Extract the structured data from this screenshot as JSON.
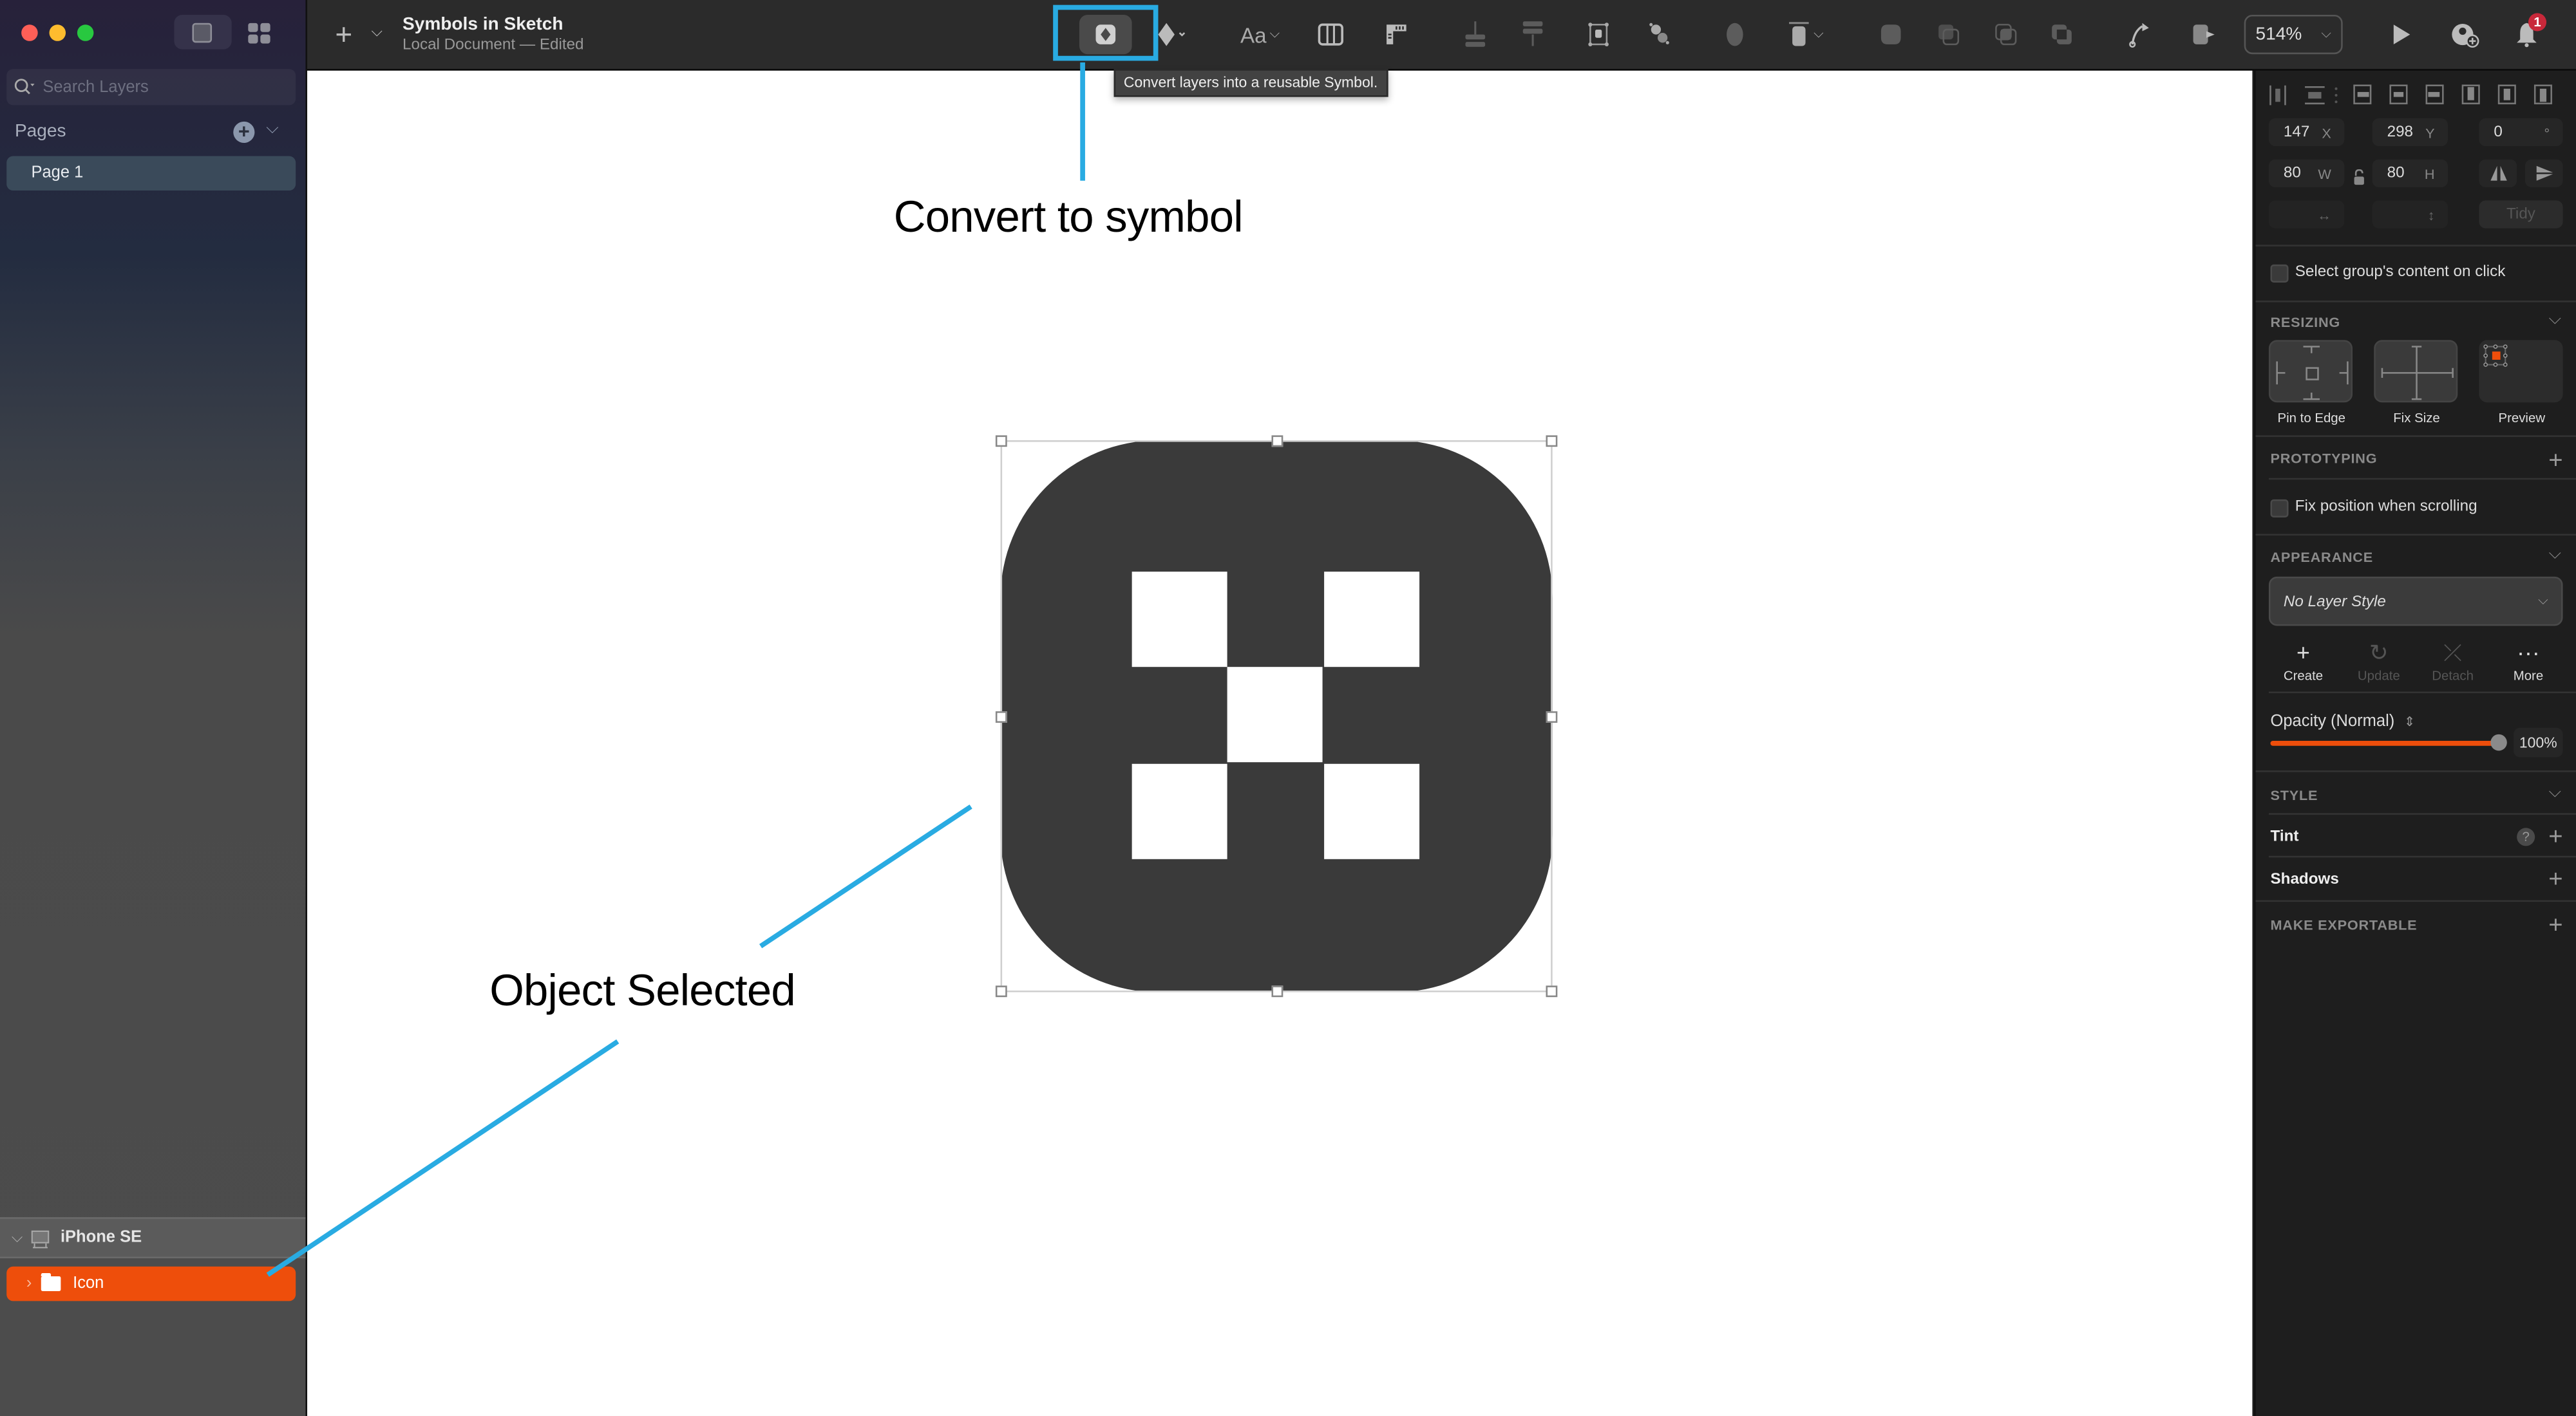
{
  "window": {
    "title": "Symbols in Sketch",
    "subtitle": "Local Document — Edited"
  },
  "sidebar": {
    "search_placeholder": "Search Layers",
    "pages_label": "Pages",
    "pages": [
      {
        "label": "Page 1",
        "selected": true
      }
    ],
    "layers": [
      {
        "label": "iPhone SE",
        "type": "artboard",
        "expanded": true
      },
      {
        "label": "Icon",
        "type": "group",
        "selected": true,
        "expanded": false
      }
    ]
  },
  "toolbar": {
    "insert_icon": "+",
    "zoom_level": "514%",
    "notification_count": "1",
    "text_tool_label": "Aa",
    "icons": [
      "plus-icon",
      "create-symbol-icon",
      "component-diamond-icon",
      "text-style-icon",
      "layout-grid-icon",
      "ruler-icon",
      "distribute-icon",
      "align-bottom-icon",
      "mask-icon",
      "scale-icon",
      "flatten-icon",
      "resize-icon",
      "union-icon",
      "subtract-icon",
      "intersect-icon",
      "difference-icon",
      "path-icon",
      "export-icon",
      "zoom-select",
      "play-icon",
      "add-collaborator-icon",
      "bell-icon"
    ]
  },
  "tooltip": {
    "text": "Convert layers into a reusable Symbol."
  },
  "annotations": {
    "convert_label": "Convert to symbol",
    "selected_label": "Object Selected",
    "line_color": "#29abe2"
  },
  "inspector": {
    "x": "147",
    "x_label": "X",
    "y": "298",
    "y_label": "Y",
    "rotation": "0",
    "rotation_label": "°",
    "w": "80",
    "w_label": "W",
    "h": "80",
    "h_label": "H",
    "tidy_label": "Tidy",
    "select_group_content": "Select group's content on click",
    "resizing": {
      "title": "RESIZING",
      "options": [
        "Pin to Edge",
        "Fix Size",
        "Preview"
      ]
    },
    "prototyping": {
      "title": "PROTOTYPING",
      "fix_position": "Fix position when scrolling"
    },
    "appearance": {
      "title": "APPEARANCE",
      "layer_style": "No Layer Style",
      "actions": [
        {
          "label": "Create",
          "enabled": true
        },
        {
          "label": "Update",
          "enabled": false
        },
        {
          "label": "Detach",
          "enabled": false
        },
        {
          "label": "More",
          "enabled": true
        }
      ],
      "opacity_label": "Opacity (Normal)",
      "opacity_value": "100%",
      "opacity_fraction": 1.0
    },
    "style": {
      "title": "STYLE",
      "tint": "Tint",
      "shadows": "Shadows"
    },
    "make_exportable": "MAKE EXPORTABLE"
  },
  "colors": {
    "accent": "#ee4e0b",
    "annotation": "#29abe2",
    "icon_fill": "#3a3a3a",
    "badge": "#c8283a"
  }
}
